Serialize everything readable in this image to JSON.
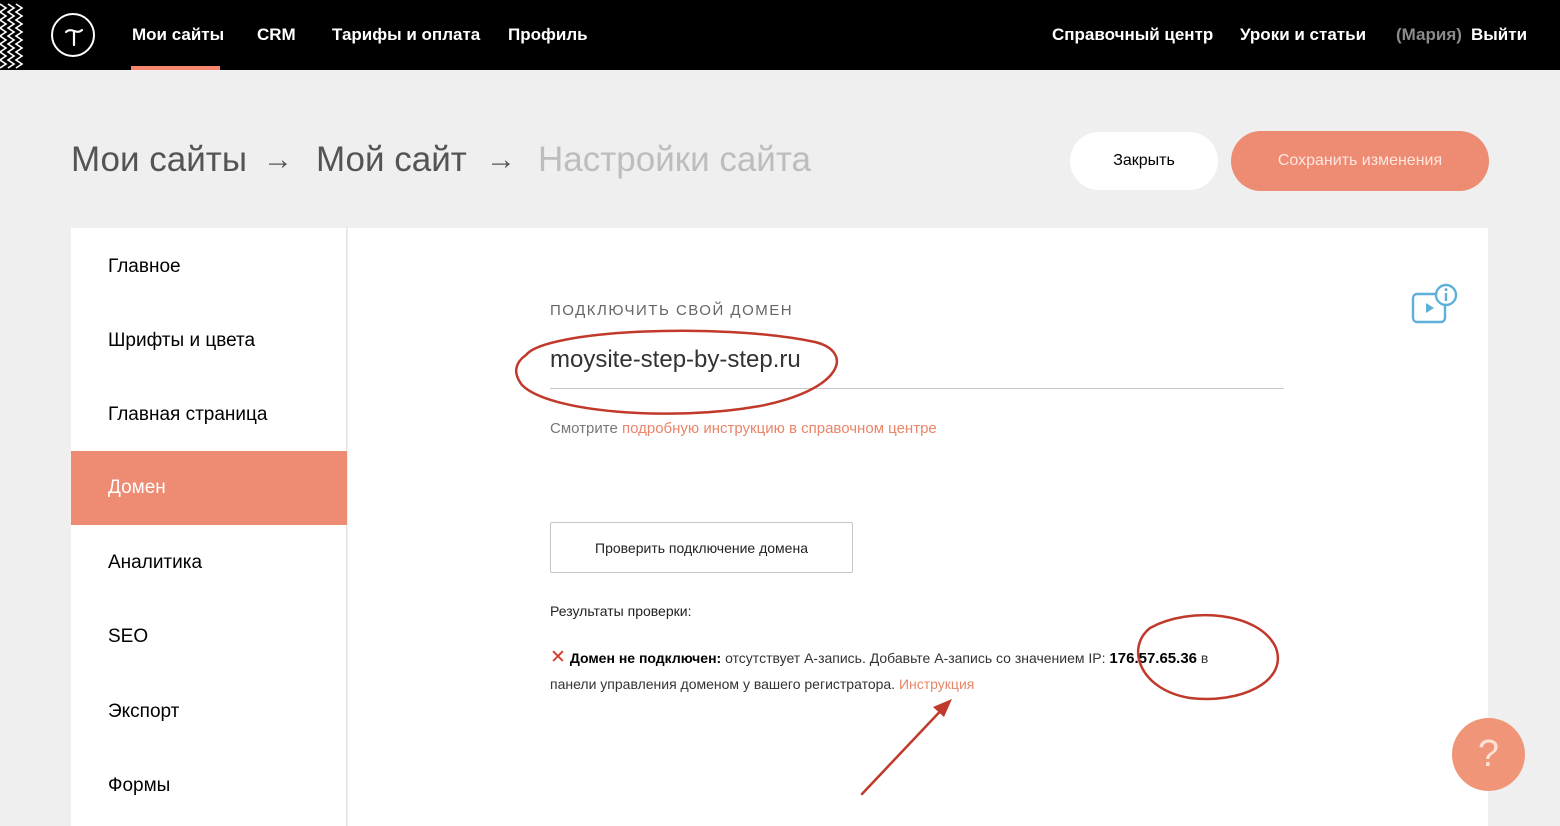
{
  "nav": {
    "items": [
      "Мои сайты",
      "CRM",
      "Тарифы и оплата",
      "Профиль"
    ],
    "right": {
      "help_center": "Справочный центр",
      "lessons": "Уроки и статьи",
      "user": "(Мария)",
      "logout": "Выйти"
    }
  },
  "breadcrumb": {
    "sites": "Мои сайты",
    "site": "Мой сайт",
    "current": "Настройки сайта",
    "separator": "→"
  },
  "actions": {
    "close": "Закрыть",
    "save": "Сохранить изменения"
  },
  "sidebar": {
    "items": [
      "Главное",
      "Шрифты и цвета",
      "Главная страница",
      "Домен",
      "Аналитика",
      "SEO",
      "Экспорт",
      "Формы"
    ],
    "active": "Домен"
  },
  "domain": {
    "label": "ПОДКЛЮЧИТЬ СВОЙ ДОМЕН",
    "value": "moysite-step-by-step.ru",
    "hint_prefix": "Смотрите ",
    "hint_link": "подробную инструкцию в справочном центре"
  },
  "check": {
    "button": "Проверить подключение домена",
    "results_label": "Результаты проверки:",
    "x_mark": "✕",
    "status": "Домен не подключен:",
    "message_part1": " отсутствует А-запись. Добавьте А-запись со значением IP: ",
    "ip": "176.57.65.36",
    "message_part2": " в",
    "message_line2": "панели управления доменом у вашего регистратора. ",
    "instruction_link": "Инструкция"
  },
  "help": {
    "label": "?"
  },
  "colors": {
    "accent": "#ee8b73",
    "annotation": "#c0392b"
  },
  "icons": {
    "logo": "tilda-logo-icon",
    "video_info": "video-info-icon",
    "help": "question-icon"
  }
}
